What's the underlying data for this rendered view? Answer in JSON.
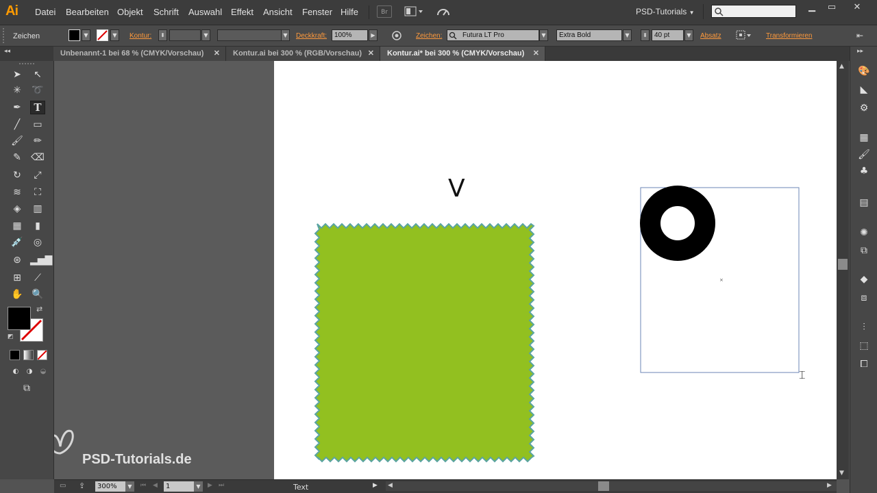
{
  "app": {
    "logo": "Ai",
    "workspace": "PSD-Tutorials"
  },
  "menu": [
    "Datei",
    "Bearbeiten",
    "Objekt",
    "Schrift",
    "Auswahl",
    "Effekt",
    "Ansicht",
    "Fenster",
    "Hilfe"
  ],
  "menu_icons": {
    "bridge": "Br",
    "arrange": "arrange-documents-icon",
    "gpu": "gpu-performance-icon"
  },
  "control_bar": {
    "context": "Zeichen",
    "stroke_label": "Kontur:",
    "opacity_label": "Deckkraft:",
    "opacity_value": "100%",
    "character_label": "Zeichen:",
    "font_family": "Futura LT Pro",
    "font_style": "Extra Bold",
    "font_size": "40 pt",
    "paragraph_label": "Absatz",
    "transform_label": "Transformieren"
  },
  "tabs": [
    {
      "label": "Unbenannt-1 bei 68 % (CMYK/Vorschau)",
      "active": false
    },
    {
      "label": "Kontur.ai bei 300 % (RGB/Vorschau)",
      "active": false
    },
    {
      "label": "Kontur.ai* bei 300 % (CMYK/Vorschau)",
      "active": true
    }
  ],
  "artwork": {
    "glyph_text": "V",
    "green_fill": "#92c020",
    "zigzag_stroke": "#5aa4a2",
    "selection_color": "#6b86b5",
    "ring_color": "#000000"
  },
  "status_bar": {
    "zoom": "300%",
    "page": "1",
    "mode": "Text"
  },
  "watermark": {
    "text": "PSD-Tutorials.de"
  },
  "colors": {
    "accent_link": "#ff9a3c",
    "ui_bg": "#535353",
    "artboard": "#ffffff"
  }
}
